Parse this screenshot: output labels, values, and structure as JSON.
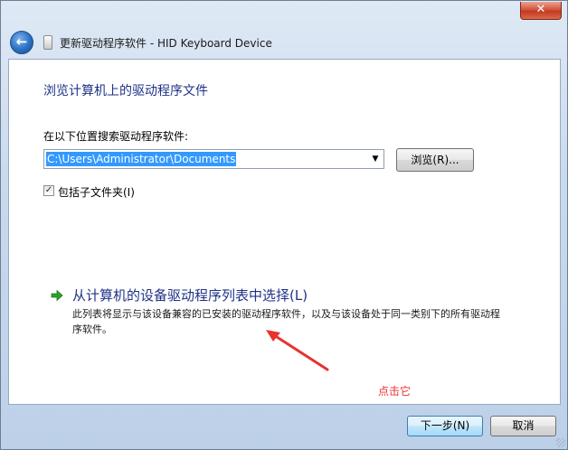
{
  "window": {
    "title": "更新驱动程序软件 - HID Keyboard Device",
    "close_glyph": "✕",
    "back_glyph": "←"
  },
  "page": {
    "heading": "浏览计算机上的驱动程序文件",
    "search_label": "在以下位置搜索驱动程序软件:",
    "path_value": "C:\\Users\\Administrator\\Documents",
    "browse_label": "浏览(R)...",
    "include_subfolders_label": "包括子文件夹(I)",
    "include_subfolders_checked": true,
    "check_glyph": "✓",
    "dropdown_glyph": "▼"
  },
  "pick_option": {
    "title": "从计算机的设备驱动程序列表中选择(L)",
    "description": "此列表将显示与该设备兼容的已安装的驱动程序软件，以及与该设备处于同一类别下的所有驱动程序软件。"
  },
  "annotation": {
    "text": "点击它",
    "color": "#e8322f"
  },
  "footer": {
    "next_label": "下一步(N)",
    "cancel_label": "取消"
  },
  "colors": {
    "heading": "#1e3287",
    "selection": "#3399ff",
    "option_arrow": "#2ca02c"
  }
}
